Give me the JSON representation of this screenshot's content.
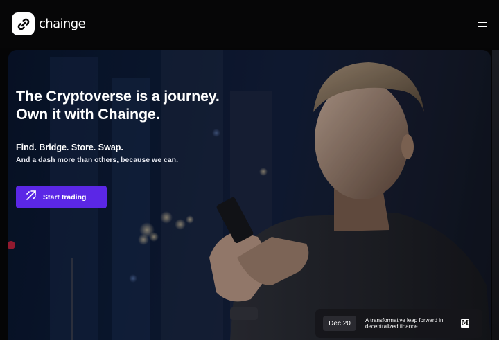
{
  "header": {
    "logo_text": "chainge",
    "menu_icon": "hamburger-menu-icon"
  },
  "hero": {
    "headline_line1": "The Cryptoverse is a journey.",
    "headline_line2": "Own it with Chainge.",
    "subhead": "Find. Bridge. Store. Swap.",
    "subtext": "And a dash more than others, because we can.",
    "cta_label": "Start trading",
    "cta_icon": "trading-arrow-icon",
    "accent_color": "#5b27e6"
  },
  "news": {
    "date": "Dec 20",
    "title": "A transformative leap forward in decentralized finance",
    "source_icon": "medium-icon",
    "source_letter": "M"
  }
}
